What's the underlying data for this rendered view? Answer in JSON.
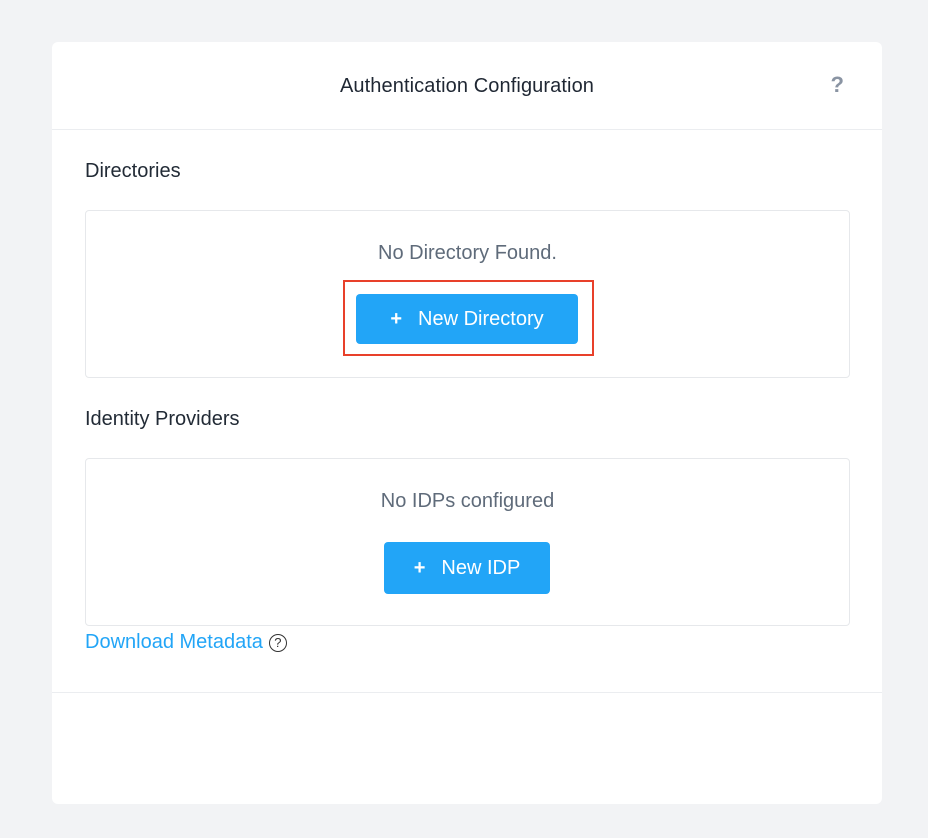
{
  "header": {
    "title": "Authentication Configuration",
    "help_label": "?"
  },
  "directories": {
    "section_title": "Directories",
    "empty_text": "No Directory Found.",
    "new_button_label": "New Directory",
    "new_button_icon": "plus-icon"
  },
  "idp": {
    "section_title": "Identity Providers",
    "empty_text": "No IDPs configured",
    "new_button_label": "New IDP",
    "new_button_icon": "plus-icon"
  },
  "download": {
    "link_label": "Download Metadata",
    "help_label": "?"
  },
  "colors": {
    "accent": "#22a5f7",
    "highlight": "#e8402a",
    "background": "#f2f3f5"
  }
}
